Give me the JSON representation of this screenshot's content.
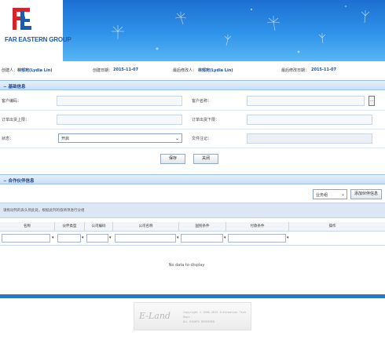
{
  "header": {
    "company_name": "FAR EASTERN GROUP",
    "brand_color": "#2f93ea"
  },
  "info": {
    "creator_label": "创建人：",
    "creator_value": "林郁宛(Lydia Lin)",
    "created_date_label": "创建日期：",
    "created_date_value": "2015-11-07",
    "modifier_label": "最后修改人：",
    "modifier_value": "林郁宛(Lydia Lin)",
    "modified_date_label": "最后修改日期：",
    "modified_date_value": "2015-11-07"
  },
  "basic_section": {
    "title": "基础信息",
    "collapse_icon": "minus-icon"
  },
  "form": {
    "customer_code_label": "客户编码：",
    "customer_code_value": "",
    "customer_name_label": "客户名称：",
    "customer_name_value": "",
    "lookup_button_label": "...",
    "order_upper_label": "订单出货上限：",
    "order_upper_value": "",
    "order_lower_label": "订单出货下限：",
    "order_lower_value": "",
    "status_label": "状态：",
    "status_value": "开启",
    "doc_mark_label": "文件注记：",
    "doc_mark_value": ""
  },
  "actions": {
    "save_label": "保存",
    "close_label": "关闭"
  },
  "partner_section": {
    "title": "合作伙伴信息",
    "collapse_icon": "minus-icon",
    "type_select_value": "业务组",
    "add_partner_label": "添加伙伴信息"
  },
  "hint": {
    "text": "请拖动列的表头到此处，根据此列的值将项进行分组"
  },
  "grid": {
    "columns": [
      "名称",
      "伙伴类型",
      "公司编码",
      "公司名称",
      "国别条件",
      "付款条件",
      "操作"
    ],
    "rows": [],
    "empty_text": "No data to display"
  },
  "footer": {
    "logo_text": "E-Land",
    "copyright_line1": "Copyright © 2006-2015 Information Tech Dept.",
    "copyright_line2": "ALL RIGHTS RESERVED"
  }
}
